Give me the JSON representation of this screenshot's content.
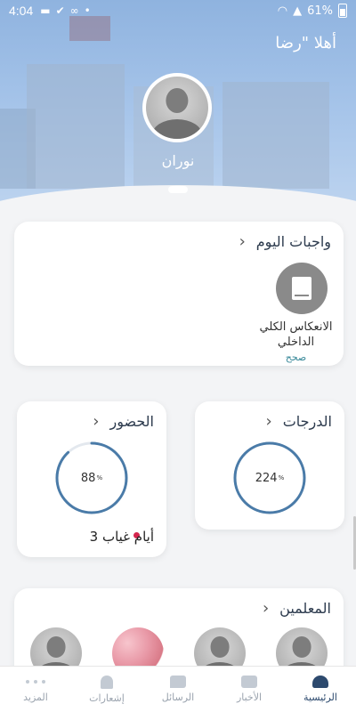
{
  "status_bar": {
    "time": "4:04",
    "battery": "61%"
  },
  "header": {
    "greeting": "أهلا \"رضا",
    "child_name": "نوران"
  },
  "homework": {
    "title": "واجبات اليوم",
    "subject": "الانعكاس الكلي الداخلي",
    "status": "صحح"
  },
  "attendance": {
    "title": "الحضور",
    "percent": "88",
    "percent_value": 88,
    "absence_text": "3 أيام غياب"
  },
  "grades": {
    "title": "الدرجات",
    "percent": "224",
    "percent_value": 100
  },
  "teachers": {
    "title": "المعلمين"
  },
  "colors": {
    "accent": "#2d4a6e",
    "ring": "#4a7ba8",
    "absence_dot": "#d4254d"
  },
  "nav": {
    "home": "الرئيسية",
    "news": "الأخبار",
    "messages": "الرسائل",
    "notifications": "إشعارات",
    "more": "المزيد"
  }
}
